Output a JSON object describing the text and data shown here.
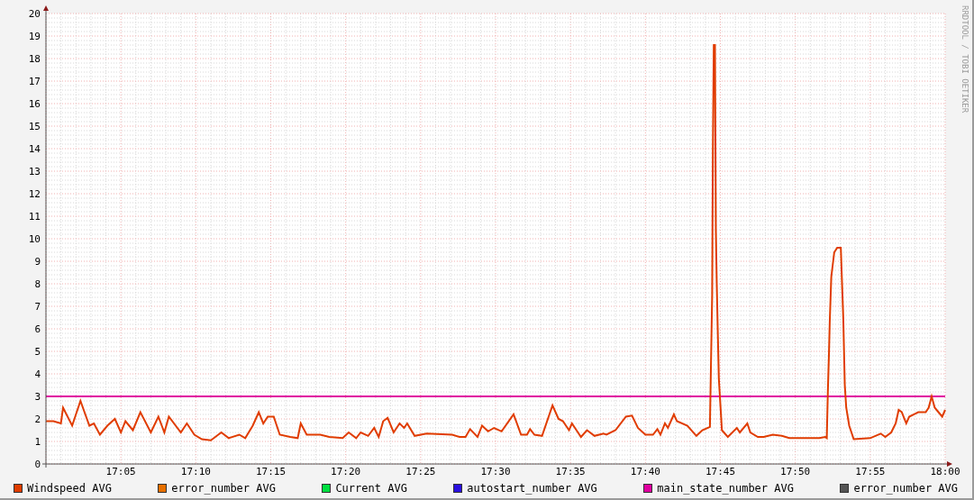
{
  "chart_data": {
    "type": "line",
    "grid": true,
    "xlim": [
      1020,
      1080
    ],
    "ylim": [
      0,
      20
    ],
    "yticks": [
      0,
      1,
      2,
      3,
      4,
      5,
      6,
      7,
      8,
      9,
      10,
      11,
      12,
      13,
      14,
      15,
      16,
      17,
      18,
      19,
      20
    ],
    "xticks": [
      {
        "value": 1025,
        "label": "17:05"
      },
      {
        "value": 1030,
        "label": "17:10"
      },
      {
        "value": 1035,
        "label": "17:15"
      },
      {
        "value": 1040,
        "label": "17:20"
      },
      {
        "value": 1045,
        "label": "17:25"
      },
      {
        "value": 1050,
        "label": "17:30"
      },
      {
        "value": 1055,
        "label": "17:35"
      },
      {
        "value": 1060,
        "label": "17:40"
      },
      {
        "value": 1065,
        "label": "17:45"
      },
      {
        "value": 1070,
        "label": "17:50"
      },
      {
        "value": 1075,
        "label": "17:55"
      },
      {
        "value": 1080,
        "label": "18:00"
      }
    ],
    "x": [
      1020,
      1020.5,
      1021,
      1021.14,
      1021.75,
      1022.3,
      1022.9,
      1023.2,
      1023.6,
      1024.1,
      1024.6,
      1025,
      1025.3,
      1025.8,
      1026.3,
      1027,
      1027.5,
      1027.9,
      1028.2,
      1029,
      1029.4,
      1029.9,
      1030.4,
      1031,
      1031.3,
      1031.7,
      1032.2,
      1032.9,
      1033.3,
      1033.8,
      1034.2,
      1034.5,
      1034.8,
      1035.2,
      1035.6,
      1036.3,
      1036.8,
      1037,
      1037.4,
      1038.3,
      1038.9,
      1039.8,
      1040.2,
      1040.7,
      1041,
      1041.5,
      1041.9,
      1042.2,
      1042.5,
      1042.8,
      1043.2,
      1043.6,
      1043.9,
      1044.1,
      1044.6,
      1045.4,
      1047.1,
      1047.6,
      1048,
      1048.3,
      1048.8,
      1049.1,
      1049.5,
      1049.9,
      1050.4,
      1051.2,
      1051.7,
      1052.1,
      1052.3,
      1052.6,
      1053.1,
      1053.8,
      1054.2,
      1054.5,
      1054.9,
      1055.1,
      1055.7,
      1056.1,
      1056.6,
      1057.2,
      1057.4,
      1058,
      1058.7,
      1059.1,
      1059.5,
      1060,
      1060.5,
      1060.8,
      1061,
      1061.3,
      1061.5,
      1061.9,
      1062.1,
      1062.8,
      1063.4,
      1063.8,
      1064.3,
      1064.45,
      1064.5,
      1064.56,
      1064.64,
      1064.7,
      1064.76,
      1064.82,
      1064.9,
      1065.1,
      1065.5,
      1066.1,
      1066.3,
      1066.8,
      1067,
      1067.5,
      1067.9,
      1068.5,
      1069.1,
      1069.6,
      1071.6,
      1072,
      1072.1,
      1072.17,
      1072.25,
      1072.3,
      1072.4,
      1072.6,
      1072.8,
      1073.04,
      1073.1,
      1073.2,
      1073.3,
      1073.4,
      1073.6,
      1073.9,
      1075,
      1075.7,
      1076,
      1076.4,
      1076.7,
      1076.9,
      1077.1,
      1077.4,
      1077.6,
      1078.2,
      1078.7,
      1078.9,
      1079.1,
      1079.3,
      1079.8,
      1080
    ],
    "series": [
      {
        "name": "Windspeed AVG",
        "color": "#e03c00",
        "values": [
          1.9,
          1.9,
          1.8,
          2.5,
          1.7,
          2.8,
          1.7,
          1.8,
          1.3,
          1.7,
          2.0,
          1.4,
          1.9,
          1.5,
          2.3,
          1.4,
          2.1,
          1.4,
          2.1,
          1.4,
          1.8,
          1.3,
          1.1,
          1.05,
          1.2,
          1.4,
          1.15,
          1.3,
          1.15,
          1.7,
          2.3,
          1.8,
          2.1,
          2.1,
          1.3,
          1.2,
          1.15,
          1.8,
          1.3,
          1.3,
          1.2,
          1.15,
          1.4,
          1.15,
          1.4,
          1.25,
          1.6,
          1.2,
          1.9,
          2.05,
          1.4,
          1.8,
          1.6,
          1.8,
          1.25,
          1.35,
          1.3,
          1.2,
          1.2,
          1.55,
          1.2,
          1.7,
          1.45,
          1.6,
          1.45,
          2.2,
          1.3,
          1.3,
          1.55,
          1.3,
          1.25,
          2.6,
          2.0,
          1.9,
          1.5,
          1.8,
          1.2,
          1.5,
          1.25,
          1.35,
          1.3,
          1.5,
          2.1,
          2.15,
          1.6,
          1.3,
          1.3,
          1.55,
          1.3,
          1.8,
          1.6,
          2.2,
          1.9,
          1.7,
          1.25,
          1.5,
          1.65,
          7.5,
          13.9,
          18.6,
          18.6,
          10.4,
          8.0,
          6.1,
          3.8,
          1.5,
          1.2,
          1.6,
          1.4,
          1.8,
          1.4,
          1.2,
          1.2,
          1.3,
          1.25,
          1.15,
          1.15,
          1.2,
          1.15,
          3.2,
          5.0,
          6.3,
          8.3,
          9.4,
          9.6,
          9.6,
          8.4,
          6.5,
          3.5,
          2.5,
          1.7,
          1.1,
          1.15,
          1.35,
          1.2,
          1.4,
          1.8,
          2.4,
          2.3,
          1.8,
          2.1,
          2.3,
          2.3,
          2.5,
          3.0,
          2.5,
          2.1,
          2.4
        ]
      },
      {
        "name": "main_state_number AVG",
        "color": "#e000a0",
        "values": [
          3,
          3,
          3,
          3,
          3,
          3,
          3,
          3,
          3,
          3,
          3,
          3,
          3,
          3,
          3,
          3,
          3,
          3,
          3,
          3,
          3,
          3,
          3,
          3,
          3,
          3,
          3,
          3,
          3,
          3,
          3,
          3,
          3,
          3,
          3,
          3,
          3,
          3,
          3,
          3,
          3,
          3,
          3,
          3,
          3,
          3,
          3,
          3,
          3,
          3,
          3,
          3,
          3,
          3,
          3,
          3,
          3,
          3,
          3,
          3,
          3,
          3,
          3,
          3,
          3,
          3,
          3,
          3,
          3,
          3,
          3,
          3,
          3,
          3,
          3,
          3,
          3,
          3,
          3,
          3,
          3,
          3,
          3,
          3,
          3,
          3,
          3,
          3,
          3,
          3,
          3,
          3,
          3,
          3,
          3,
          3,
          3,
          3,
          3,
          3,
          3,
          3,
          3,
          3,
          3,
          3,
          3,
          3,
          3,
          3,
          3,
          3,
          3,
          3,
          3,
          3,
          3,
          3,
          3,
          3,
          3,
          3,
          3,
          3,
          3,
          3,
          3,
          3,
          3,
          3,
          3,
          3,
          3,
          3,
          3,
          3,
          3,
          3,
          3,
          3,
          3,
          3,
          3,
          3,
          3,
          3,
          3,
          3
        ]
      }
    ]
  },
  "credit": "RRDTOOL / TOBI OETIKER",
  "legend": [
    {
      "kind": "series"
    },
    {
      "label": "error_number AVG",
      "color": "#e87000"
    },
    {
      "label": "Current AVG",
      "color": "#00e040"
    },
    {
      "label": "autostart_number AVG",
      "color": "#2a10e0"
    },
    {
      "kind": "series"
    },
    {
      "label": "error_number AVG",
      "color": "#555555"
    }
  ]
}
